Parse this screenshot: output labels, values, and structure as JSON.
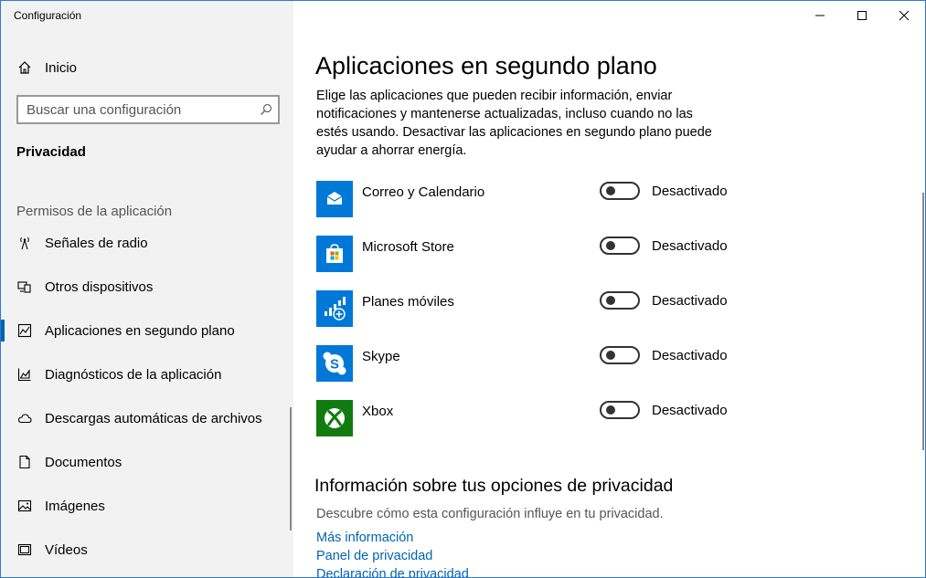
{
  "window": {
    "title": "Configuración",
    "accent": "#2b7bd3"
  },
  "sidebar": {
    "home_label": "Inicio",
    "search_placeholder": "Buscar una configuración",
    "section_title": "Privacidad",
    "group_label": "Permisos de la aplicación",
    "items": [
      {
        "label": "Señales de radio",
        "icon": "radio-antenna-icon",
        "active": false
      },
      {
        "label": "Otros dispositivos",
        "icon": "devices-icon",
        "active": false
      },
      {
        "label": "Aplicaciones en segundo plano",
        "icon": "background-apps-icon",
        "active": true
      },
      {
        "label": "Diagnósticos de la aplicación",
        "icon": "diagnostics-chart-icon",
        "active": false
      },
      {
        "label": "Descargas automáticas de archivos",
        "icon": "cloud-icon",
        "active": false
      },
      {
        "label": "Documentos",
        "icon": "document-icon",
        "active": false
      },
      {
        "label": "Imágenes",
        "icon": "image-icon",
        "active": false
      },
      {
        "label": "Vídeos",
        "icon": "video-icon",
        "active": false
      }
    ]
  },
  "main": {
    "title": "Aplicaciones en segundo plano",
    "description": "Elige las aplicaciones que pueden recibir información, enviar notificaciones y mantenerse actualizadas, incluso cuando no las estés usando. Desactivar las aplicaciones en segundo plano puede ayudar a ahorrar energía.",
    "apps": [
      {
        "name": "Correo y Calendario",
        "state": "Desactivado",
        "icon": "mail-icon",
        "color": "#0078d7"
      },
      {
        "name": "Microsoft Store",
        "state": "Desactivado",
        "icon": "store-bag-icon",
        "color": "#0078d7"
      },
      {
        "name": "Planes móviles",
        "state": "Desactivado",
        "icon": "signal-plus-icon",
        "color": "#0078d7"
      },
      {
        "name": "Skype",
        "state": "Desactivado",
        "icon": "skype-icon",
        "color": "#0078d7"
      },
      {
        "name": "Xbox",
        "state": "Desactivado",
        "icon": "xbox-icon",
        "color": "#107c10"
      }
    ],
    "info": {
      "title": "Información sobre tus opciones de privacidad",
      "description": "Descubre cómo esta configuración influye en tu privacidad.",
      "links": [
        "Más información",
        "Panel de privacidad",
        "Declaración de privacidad"
      ]
    }
  }
}
